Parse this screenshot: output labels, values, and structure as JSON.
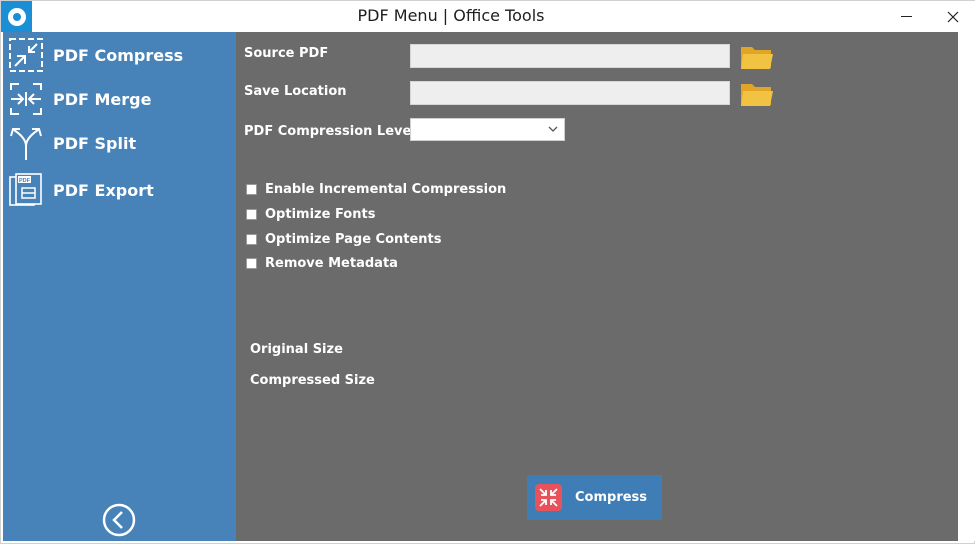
{
  "window": {
    "title": "PDF Menu | Office Tools"
  },
  "sidebar": {
    "items": [
      {
        "label": "PDF Compress",
        "icon": "compress-icon"
      },
      {
        "label": "PDF Merge",
        "icon": "merge-icon"
      },
      {
        "label": "PDF Split",
        "icon": "split-icon"
      },
      {
        "label": "PDF Export",
        "icon": "pdf-export-icon"
      }
    ],
    "back_icon": "back-arrow-icon"
  },
  "form": {
    "source_pdf_label": "Source PDF",
    "source_pdf_value": "",
    "save_location_label": "Save Location",
    "save_location_value": "",
    "compression_level_label": "PDF Compression Level",
    "compression_level_value": ""
  },
  "options": [
    {
      "label": "Enable Incremental Compression",
      "checked": false
    },
    {
      "label": "Optimize Fonts",
      "checked": false
    },
    {
      "label": "Optimize Page Contents",
      "checked": false
    },
    {
      "label": "Remove Metadata",
      "checked": false
    }
  ],
  "results": {
    "original_size_label": "Original Size",
    "compressed_size_label": "Compressed Size"
  },
  "actions": {
    "compress_label": "Compress"
  },
  "colors": {
    "sidebar": "#4782b8",
    "content": "#6b6b6b",
    "accent": "#1a8fd6",
    "button": "#3f7db7",
    "button_icon": "#e7525b",
    "folder": "#f2c343"
  }
}
